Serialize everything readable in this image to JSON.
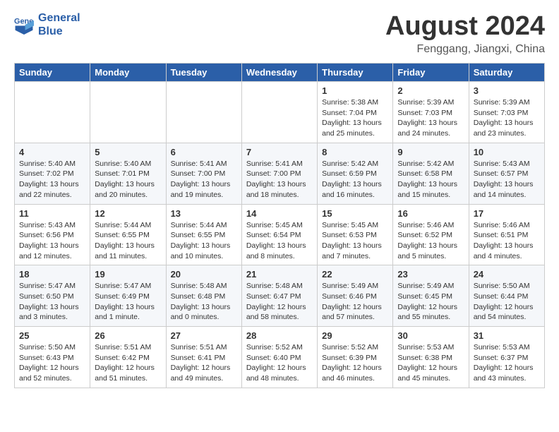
{
  "header": {
    "logo_line1": "General",
    "logo_line2": "Blue",
    "month_title": "August 2024",
    "location": "Fenggang, Jiangxi, China"
  },
  "days_of_week": [
    "Sunday",
    "Monday",
    "Tuesday",
    "Wednesday",
    "Thursday",
    "Friday",
    "Saturday"
  ],
  "weeks": [
    [
      {
        "num": "",
        "empty": true
      },
      {
        "num": "",
        "empty": true
      },
      {
        "num": "",
        "empty": true
      },
      {
        "num": "",
        "empty": true
      },
      {
        "num": "1",
        "sunrise": "5:38 AM",
        "sunset": "7:04 PM",
        "daylight": "13 hours and 25 minutes."
      },
      {
        "num": "2",
        "sunrise": "5:39 AM",
        "sunset": "7:03 PM",
        "daylight": "13 hours and 24 minutes."
      },
      {
        "num": "3",
        "sunrise": "5:39 AM",
        "sunset": "7:03 PM",
        "daylight": "13 hours and 23 minutes."
      }
    ],
    [
      {
        "num": "4",
        "sunrise": "5:40 AM",
        "sunset": "7:02 PM",
        "daylight": "13 hours and 22 minutes."
      },
      {
        "num": "5",
        "sunrise": "5:40 AM",
        "sunset": "7:01 PM",
        "daylight": "13 hours and 20 minutes."
      },
      {
        "num": "6",
        "sunrise": "5:41 AM",
        "sunset": "7:00 PM",
        "daylight": "13 hours and 19 minutes."
      },
      {
        "num": "7",
        "sunrise": "5:41 AM",
        "sunset": "7:00 PM",
        "daylight": "13 hours and 18 minutes."
      },
      {
        "num": "8",
        "sunrise": "5:42 AM",
        "sunset": "6:59 PM",
        "daylight": "13 hours and 16 minutes."
      },
      {
        "num": "9",
        "sunrise": "5:42 AM",
        "sunset": "6:58 PM",
        "daylight": "13 hours and 15 minutes."
      },
      {
        "num": "10",
        "sunrise": "5:43 AM",
        "sunset": "6:57 PM",
        "daylight": "13 hours and 14 minutes."
      }
    ],
    [
      {
        "num": "11",
        "sunrise": "5:43 AM",
        "sunset": "6:56 PM",
        "daylight": "13 hours and 12 minutes."
      },
      {
        "num": "12",
        "sunrise": "5:44 AM",
        "sunset": "6:55 PM",
        "daylight": "13 hours and 11 minutes."
      },
      {
        "num": "13",
        "sunrise": "5:44 AM",
        "sunset": "6:55 PM",
        "daylight": "13 hours and 10 minutes."
      },
      {
        "num": "14",
        "sunrise": "5:45 AM",
        "sunset": "6:54 PM",
        "daylight": "13 hours and 8 minutes."
      },
      {
        "num": "15",
        "sunrise": "5:45 AM",
        "sunset": "6:53 PM",
        "daylight": "13 hours and 7 minutes."
      },
      {
        "num": "16",
        "sunrise": "5:46 AM",
        "sunset": "6:52 PM",
        "daylight": "13 hours and 5 minutes."
      },
      {
        "num": "17",
        "sunrise": "5:46 AM",
        "sunset": "6:51 PM",
        "daylight": "13 hours and 4 minutes."
      }
    ],
    [
      {
        "num": "18",
        "sunrise": "5:47 AM",
        "sunset": "6:50 PM",
        "daylight": "13 hours and 3 minutes."
      },
      {
        "num": "19",
        "sunrise": "5:47 AM",
        "sunset": "6:49 PM",
        "daylight": "13 hours and 1 minute."
      },
      {
        "num": "20",
        "sunrise": "5:48 AM",
        "sunset": "6:48 PM",
        "daylight": "13 hours and 0 minutes."
      },
      {
        "num": "21",
        "sunrise": "5:48 AM",
        "sunset": "6:47 PM",
        "daylight": "12 hours and 58 minutes."
      },
      {
        "num": "22",
        "sunrise": "5:49 AM",
        "sunset": "6:46 PM",
        "daylight": "12 hours and 57 minutes."
      },
      {
        "num": "23",
        "sunrise": "5:49 AM",
        "sunset": "6:45 PM",
        "daylight": "12 hours and 55 minutes."
      },
      {
        "num": "24",
        "sunrise": "5:50 AM",
        "sunset": "6:44 PM",
        "daylight": "12 hours and 54 minutes."
      }
    ],
    [
      {
        "num": "25",
        "sunrise": "5:50 AM",
        "sunset": "6:43 PM",
        "daylight": "12 hours and 52 minutes."
      },
      {
        "num": "26",
        "sunrise": "5:51 AM",
        "sunset": "6:42 PM",
        "daylight": "12 hours and 51 minutes."
      },
      {
        "num": "27",
        "sunrise": "5:51 AM",
        "sunset": "6:41 PM",
        "daylight": "12 hours and 49 minutes."
      },
      {
        "num": "28",
        "sunrise": "5:52 AM",
        "sunset": "6:40 PM",
        "daylight": "12 hours and 48 minutes."
      },
      {
        "num": "29",
        "sunrise": "5:52 AM",
        "sunset": "6:39 PM",
        "daylight": "12 hours and 46 minutes."
      },
      {
        "num": "30",
        "sunrise": "5:53 AM",
        "sunset": "6:38 PM",
        "daylight": "12 hours and 45 minutes."
      },
      {
        "num": "31",
        "sunrise": "5:53 AM",
        "sunset": "6:37 PM",
        "daylight": "12 hours and 43 minutes."
      }
    ]
  ],
  "labels": {
    "sunrise": "Sunrise:",
    "sunset": "Sunset:",
    "daylight": "Daylight:"
  }
}
